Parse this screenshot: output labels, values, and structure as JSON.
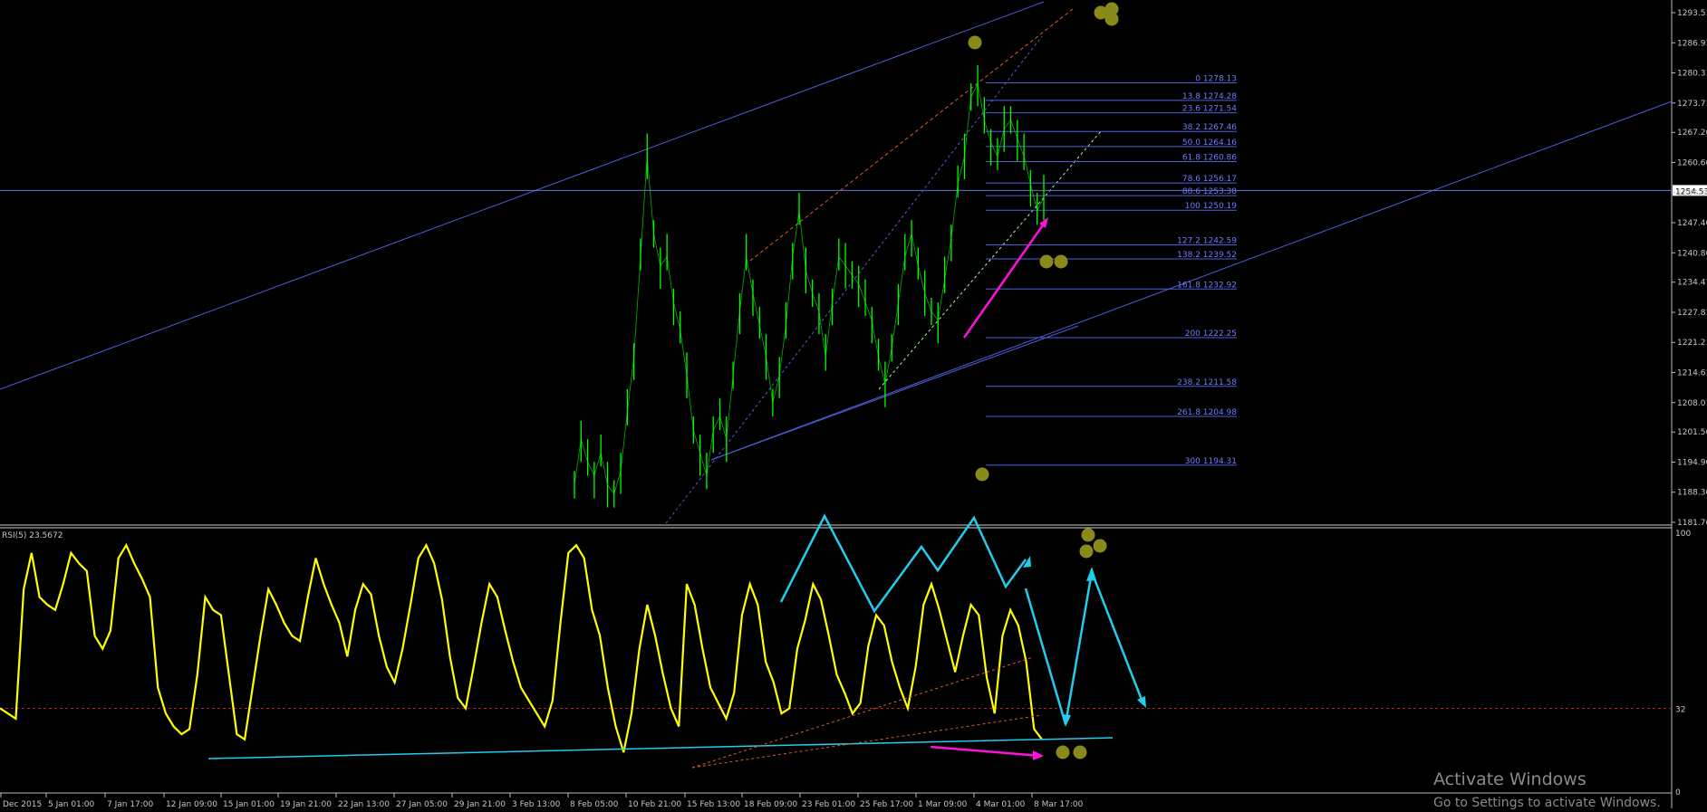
{
  "colors": {
    "background": "#000000",
    "candle": "#00ff00",
    "fib": "#4a5fd8",
    "fib_text": "#6b7cff",
    "channel": "#4a5fd8",
    "rsi_line": "#ffff00",
    "level_line": "#b22222",
    "cyan_arrow": "#22ccee",
    "magenta_arrow": "#ff11dd",
    "marker": "#8a8a1a",
    "axis_text": "#c8c8c8",
    "orange_dash": "#e05a20"
  },
  "chart_data": [
    {
      "type": "line",
      "y_axis_ticks": [
        "1293.51",
        "1286.91",
        "1280.31",
        "1273.71",
        "1267.26",
        "1260.66",
        "1254.06",
        "1247.46",
        "1240.86",
        "1234.41",
        "1227.81",
        "1221.21",
        "1214.61",
        "1208.01",
        "1201.56",
        "1194.96",
        "1188.36",
        "1181.76"
      ],
      "ylim": [
        1181.76,
        1293.51
      ],
      "current_price_label": "1254.53",
      "current_price": 1254.53,
      "fib_levels": [
        {
          "label": "0 1278.13",
          "value": 1278.13
        },
        {
          "label": "13.8 1274.28",
          "value": 1274.28
        },
        {
          "label": "23.6 1271.54",
          "value": 1271.54
        },
        {
          "label": "38.2 1267.46",
          "value": 1267.46
        },
        {
          "label": "50.0 1264.16",
          "value": 1264.16
        },
        {
          "label": "61.8 1260.86",
          "value": 1260.86
        },
        {
          "label": "78.6 1256.17",
          "value": 1256.17
        },
        {
          "label": "88.6 1253.38",
          "value": 1253.38
        },
        {
          "label": "100 1250.19",
          "value": 1250.19
        },
        {
          "label": "127.2 1242.59",
          "value": 1242.59
        },
        {
          "label": "138.2 1239.52",
          "value": 1239.52
        },
        {
          "label": "161.8 1232.92",
          "value": 1232.92
        },
        {
          "label": "200 1222.25",
          "value": 1222.25
        },
        {
          "label": "238.2 1211.58",
          "value": 1211.58
        },
        {
          "label": "261.8 1204.98",
          "value": 1204.98
        },
        {
          "label": "300 1194.31",
          "value": 1194.31
        }
      ],
      "price_series": [
        1190,
        1200,
        1195,
        1192,
        1197,
        1190,
        1188,
        1193,
        1206,
        1218,
        1240,
        1262,
        1245,
        1238,
        1240,
        1230,
        1224,
        1214,
        1202,
        1197,
        1192,
        1202,
        1205,
        1200,
        1214,
        1228,
        1240,
        1232,
        1225,
        1218,
        1208,
        1214,
        1225,
        1240,
        1250,
        1237,
        1232,
        1228,
        1218,
        1230,
        1240,
        1238,
        1236,
        1234,
        1230,
        1226,
        1218,
        1212,
        1220,
        1230,
        1240,
        1245,
        1238,
        1232,
        1228,
        1226,
        1235,
        1244,
        1256,
        1262,
        1275,
        1278,
        1270,
        1265,
        1262,
        1268,
        1270,
        1266,
        1262,
        1256,
        1250,
        1253
      ]
    },
    {
      "type": "line",
      "label": "RSI(5) 23.5672",
      "ylim": [
        0,
        100
      ],
      "y_axis_ticks": [
        "100",
        "32",
        "0"
      ],
      "level": 32,
      "x_tick_labels": [
        "Dec 2015",
        "5 Jan 01:00",
        "7 Jan 17:00",
        "12 Jan 09:00",
        "15 Jan 01:00",
        "19 Jan 21:00",
        "22 Jan 13:00",
        "27 Jan 05:00",
        "29 Jan 21:00",
        "3 Feb 13:00",
        "8 Feb 05:00",
        "10 Feb 21:00",
        "15 Feb 13:00",
        "18 Feb 09:00",
        "23 Feb 01:00",
        "25 Feb 17:00",
        "1 Mar 09:00",
        "4 Mar 01:00",
        "8 Mar 17:00"
      ],
      "rsi_series": [
        32,
        30,
        28,
        78,
        92,
        75,
        72,
        70,
        80,
        92,
        88,
        85,
        60,
        55,
        62,
        90,
        95,
        88,
        82,
        75,
        40,
        30,
        25,
        22,
        24,
        45,
        75,
        70,
        68,
        45,
        22,
        20,
        40,
        60,
        78,
        72,
        65,
        60,
        58,
        75,
        90,
        80,
        72,
        65,
        52,
        70,
        80,
        76,
        60,
        48,
        42,
        55,
        72,
        90,
        95,
        88,
        74,
        52,
        36,
        32,
        48,
        65,
        80,
        75,
        62,
        50,
        40,
        35,
        30,
        25,
        35,
        65,
        92,
        95,
        90,
        70,
        60,
        40,
        25,
        15,
        30,
        55,
        72,
        60,
        45,
        32,
        25,
        80,
        72,
        55,
        40,
        34,
        28,
        38,
        68,
        80,
        72,
        50,
        42,
        30,
        32,
        55,
        66,
        80,
        74,
        60,
        45,
        38,
        30,
        34,
        56,
        68,
        64,
        50,
        40,
        32,
        48,
        72,
        80,
        70,
        58,
        46,
        60,
        72,
        68,
        44,
        30,
        60,
        70,
        64,
        50,
        24,
        20
      ]
    }
  ],
  "watermark": {
    "title": "Activate Windows",
    "subtitle": "Go to Settings to activate Windows."
  }
}
